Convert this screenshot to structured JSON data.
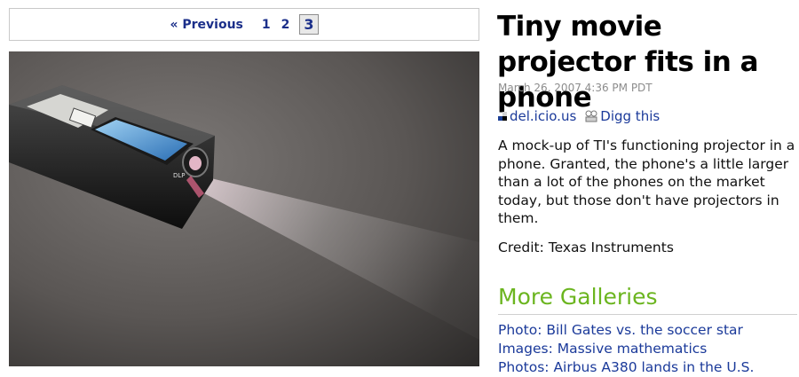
{
  "pager": {
    "previous": "« Previous",
    "pages": [
      "1",
      "2"
    ],
    "current": "3"
  },
  "photo": {
    "subject": "phone-projector-photo"
  },
  "article": {
    "title": "Tiny movie projector fits in a phone",
    "date": "March 26, 2007 4:36 PM PDT",
    "caption": "A mock-up of TI's functioning projector in a phone. Granted, the phone's a little larger than a lot of the phones on the market today, but those don't have projectors in them.",
    "credit": "Credit: Texas Instruments"
  },
  "social": {
    "delicious": "del.icio.us",
    "digg": "Digg this"
  },
  "more_galleries": {
    "title": "More Galleries",
    "links": [
      "Photo: Bill Gates vs. the soccer star",
      "Images: Massive mathematics",
      "Photos: Airbus A380 lands in the U.S."
    ]
  },
  "colors": {
    "link": "#1b3a9a",
    "pager_link": "#1b2f8a",
    "more_title": "#6bb51f",
    "date": "#8c8c8c"
  }
}
